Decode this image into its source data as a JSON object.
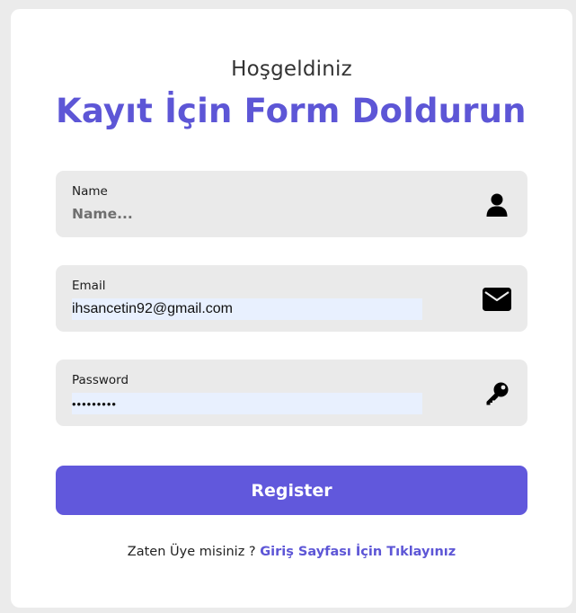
{
  "header": {
    "greeting": "Hoşgeldiniz",
    "title": "Kayıt İçin Form Doldurun"
  },
  "form": {
    "name": {
      "label": "Name",
      "placeholder": "Name...",
      "value": "",
      "icon": "user-icon"
    },
    "email": {
      "label": "Email",
      "value": "ihsancetin92@gmail.com",
      "icon": "envelope-icon"
    },
    "password": {
      "label": "Password",
      "value": "•••••••••",
      "icon": "key-icon"
    },
    "register_label": "Register"
  },
  "footer": {
    "prompt": "Zaten Üye misiniz ?",
    "link_text": "Giriş Sayfası İçin Tıklayınız"
  },
  "colors": {
    "accent": "#5d56d6",
    "button": "#6158dc",
    "field_bg": "#eaeaea",
    "autofill_bg": "#e8f0fe",
    "page_bg": "#ebebeb"
  }
}
